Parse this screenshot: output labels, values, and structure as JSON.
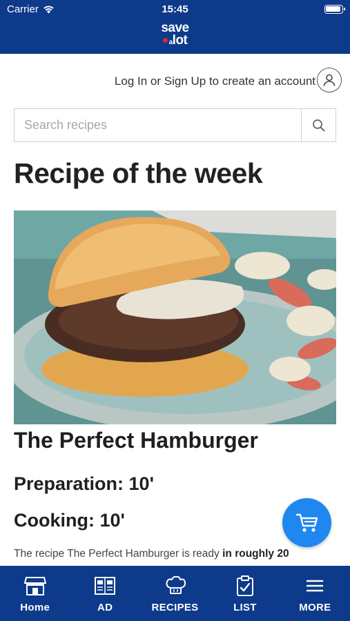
{
  "status": {
    "carrier": "Carrier",
    "time": "15:45"
  },
  "header": {
    "logo_line1": "save",
    "logo_a": "a",
    "logo_line2": "lot"
  },
  "account": {
    "prompt": "Log In or Sign Up to create an account"
  },
  "search": {
    "placeholder": "Search recipes",
    "value": ""
  },
  "section": {
    "title": "Recipe of the week"
  },
  "recipe": {
    "name": "The Perfect Hamburger",
    "preparation": "Preparation: 10'",
    "cooking": "Cooking: 10'",
    "desc_prefix": "The recipe The Perfect Hamburger is ready ",
    "desc_bold": "in roughly 20"
  },
  "nav": {
    "items": [
      {
        "label": "Home",
        "icon": "store-icon"
      },
      {
        "label": "AD",
        "icon": "flyer-icon"
      },
      {
        "label": "RECIPES",
        "icon": "chef-hat-icon"
      },
      {
        "label": "LIST",
        "icon": "clipboard-check-icon"
      },
      {
        "label": "MORE",
        "icon": "menu-icon"
      }
    ]
  },
  "colors": {
    "brand_blue": "#0d3a8a",
    "fab_blue": "#1f87f0",
    "logo_red": "#e32626"
  }
}
